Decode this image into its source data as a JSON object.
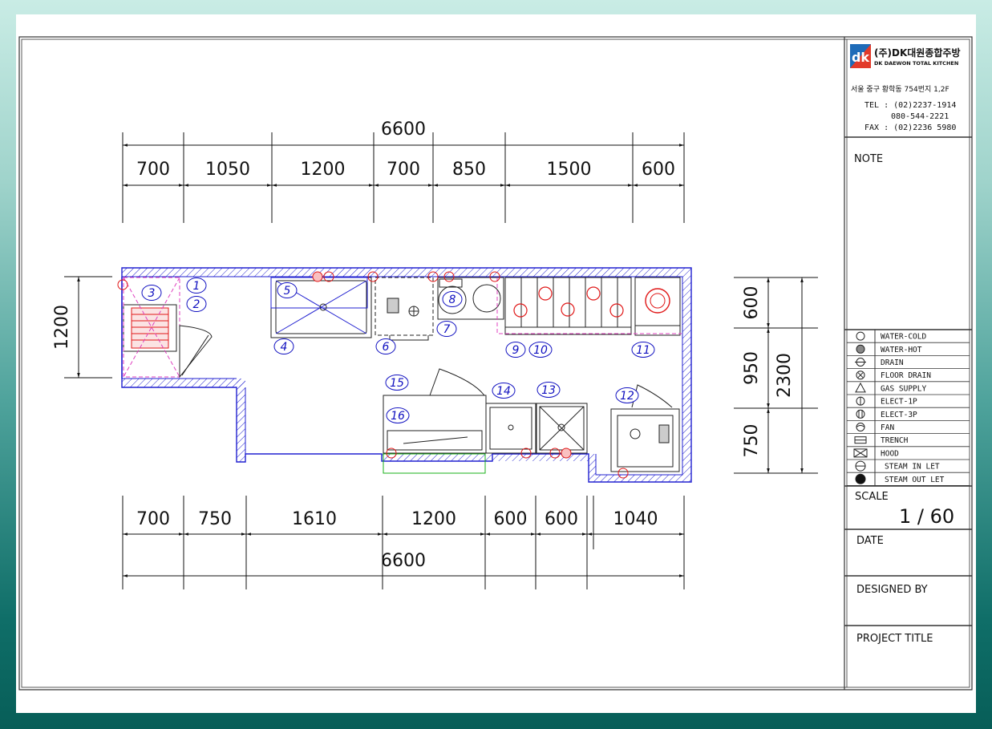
{
  "company": {
    "logo_mark": "dk",
    "name_ko": "(주)DK대원종합주방",
    "name_en": "DK DAEWON TOTAL KITCHEN",
    "address": "서울 중구 황학동 754번지 1,2F",
    "tel_1": "TEL : (02)2237-1914",
    "tel_2": "080-544-2221",
    "fax": "FAX : (02)2236  5980"
  },
  "title_block": {
    "note_label": "NOTE",
    "scale_label": "SCALE",
    "scale_value": "1 / 60",
    "date_label": "DATE",
    "designed_by_label": "DESIGNED BY",
    "project_title_label": "PROJECT TITLE"
  },
  "legend": [
    {
      "icon": "water-cold-icon",
      "label": "WATER-COLD"
    },
    {
      "icon": "water-hot-icon",
      "label": "WATER-HOT"
    },
    {
      "icon": "drain-icon",
      "label": "DRAIN"
    },
    {
      "icon": "floor-drain-icon",
      "label": "FLOOR DRAIN"
    },
    {
      "icon": "gas-supply-icon",
      "label": "GAS SUPPLY"
    },
    {
      "icon": "elect-1p-icon",
      "label": "ELECT-1P"
    },
    {
      "icon": "elect-3p-icon",
      "label": "ELECT-3P"
    },
    {
      "icon": "fan-icon",
      "label": "FAN"
    },
    {
      "icon": "trench-icon",
      "label": "TRENCH"
    },
    {
      "icon": "hood-icon",
      "label": "HOOD"
    },
    {
      "icon": "steam-in-let-icon",
      "label": "STEAM IN LET"
    },
    {
      "icon": "steam-out-let-icon",
      "label": "STEAM OUT LET"
    }
  ],
  "dimensions": {
    "top_total": "6600",
    "top_segments": [
      "700",
      "1050",
      "1200",
      "700",
      "850",
      "1500",
      "600"
    ],
    "bottom_segments": [
      "700",
      "750",
      "1610",
      "1200",
      "600",
      "600",
      "1040"
    ],
    "bottom_total": "6600",
    "left_height": "1200",
    "right_segments": [
      "600",
      "950",
      "750"
    ],
    "right_total": "2300"
  },
  "equipment_numbers": [
    "1",
    "2",
    "3",
    "4",
    "5",
    "6",
    "7",
    "8",
    "9",
    "10",
    "11",
    "12",
    "13",
    "14",
    "15",
    "16"
  ],
  "colors": {
    "wall": "#2020d0",
    "dimension": "#111111",
    "utility": "#e01818",
    "hidden_line": "#e040c0",
    "outline": "#222222"
  }
}
